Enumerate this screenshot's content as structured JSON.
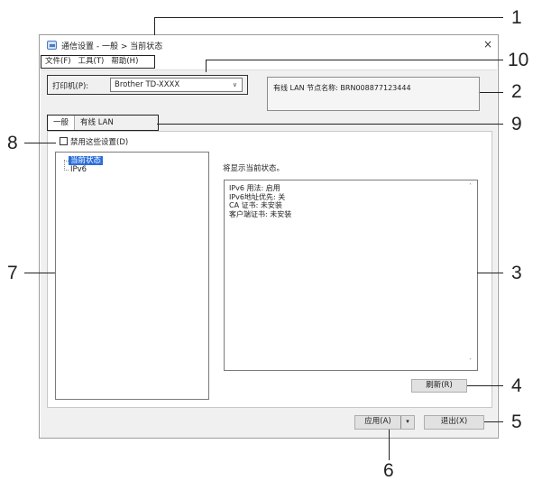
{
  "window": {
    "title": "通信设置 - 一般 > 当前状态",
    "close_glyph": "×"
  },
  "menu": [
    {
      "label": "文件(F)"
    },
    {
      "label": "工具(T)"
    },
    {
      "label": "帮助(H)"
    }
  ],
  "printer": {
    "label": "打印机(P):",
    "value": "Brother TD-XXXX",
    "chevron": "∨"
  },
  "node": {
    "text": "有线 LAN 节点名称: BRN008877123444"
  },
  "tabs": [
    {
      "label": "一般",
      "active": true
    },
    {
      "label": "有线 LAN",
      "active": false
    }
  ],
  "disable_settings": {
    "label": "禁用这些设置(D)",
    "checked": false
  },
  "tree": {
    "items": [
      {
        "label": "当前状态",
        "selected": true
      },
      {
        "label": "IPv6",
        "selected": false
      }
    ]
  },
  "status": {
    "heading": "将显示当前状态。",
    "lines": [
      "IPv6 用法: 启用",
      "IPv6地址优先: 关",
      "CA 证书: 未安装",
      "客户端证书: 未安装"
    ],
    "scroll_up": "˄",
    "scroll_down": "˅"
  },
  "buttons": {
    "refresh": "刷新(R)",
    "apply": "应用(A)",
    "apply_arrow": "▾",
    "exit": "退出(X)"
  },
  "callouts": [
    "1",
    "2",
    "3",
    "4",
    "5",
    "6",
    "7",
    "8",
    "9",
    "10"
  ],
  "colors": {
    "selection": "#2a6ddb",
    "panel": "#f0f0f0",
    "window_border": "#9c9c9c"
  }
}
